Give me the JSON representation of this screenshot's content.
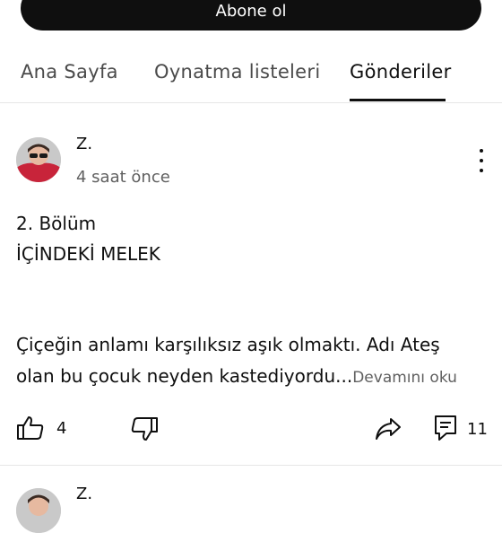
{
  "channel": {
    "subscribe_label": "Abone ol",
    "tabs": [
      {
        "label": "Ana Sayfa",
        "active": false
      },
      {
        "label": "Oynatma listeleri",
        "active": false
      },
      {
        "label": "Gönderiler",
        "active": true
      }
    ]
  },
  "post": {
    "author": "Z.",
    "time": "4 saat önce",
    "lines": [
      "2. Bölüm",
      "İÇİNDEKİ MELEK",
      "Çiçeğin anlamı karşılıksız aşık olmaktı. Adı Ateş",
      "olan bu çocuk neyden kastediyordu..."
    ],
    "read_more": "Devamını oku",
    "likes": "4",
    "comments": "11",
    "icons": {
      "like": "thumbs-up-icon",
      "dislike": "thumbs-down-icon",
      "share": "share-icon",
      "comment": "comment-icon",
      "more": "more-vertical-icon"
    }
  },
  "next_post": {
    "author": "Z."
  },
  "colors": {
    "primary_text": "#0f0f0f",
    "secondary_text": "#606060",
    "button_bg": "#0f0f0f",
    "divider": "#e6e6e6"
  }
}
